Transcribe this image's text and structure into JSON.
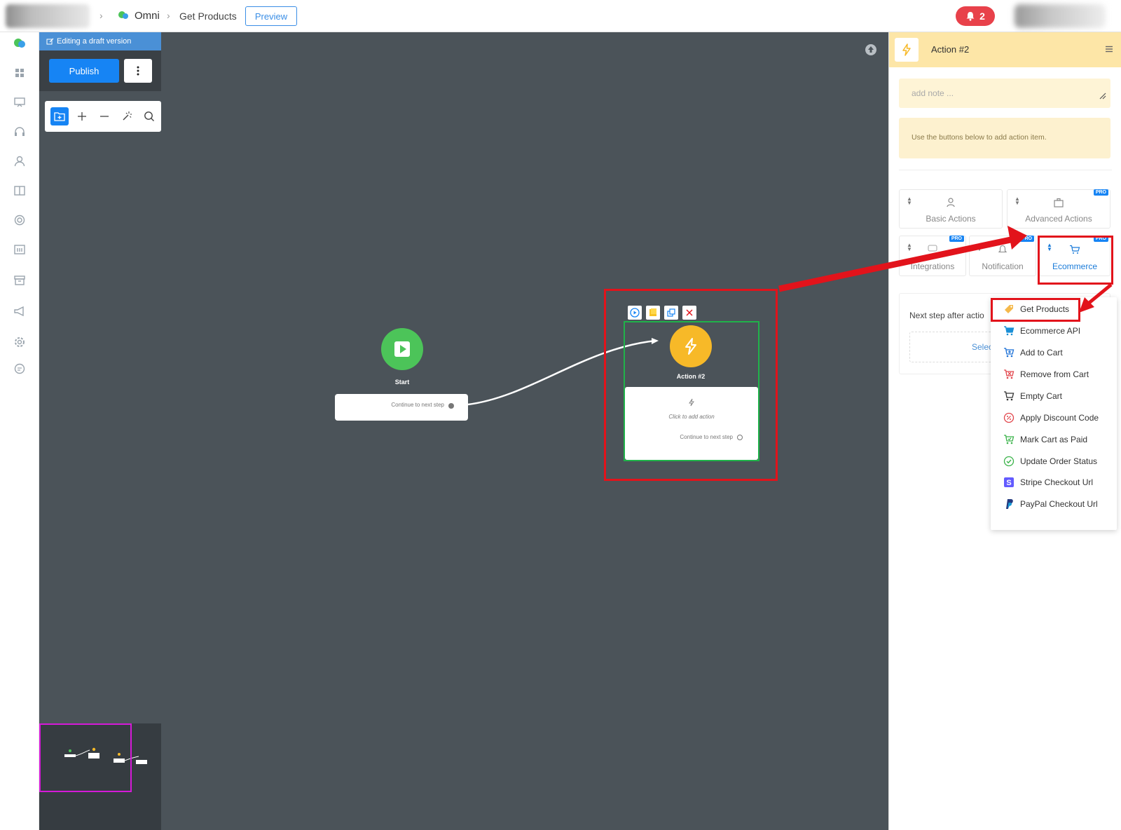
{
  "topbar": {
    "app_name": "Omni",
    "page_name": "Get Products",
    "preview_label": "Preview",
    "notification_count": "2"
  },
  "canvas": {
    "draft_label": "Editing a draft version",
    "publish_label": "Publish",
    "start_node": {
      "label": "Start",
      "continue_text": "Continue to next step"
    },
    "action_node": {
      "label": "Action #2",
      "click_text": "Click to add action",
      "continue_text": "Continue to next step"
    }
  },
  "panel": {
    "title": "Action #2",
    "note_placeholder": "add note ...",
    "hint": "Use the buttons below to add action item.",
    "categories": [
      {
        "label": "Basic Actions",
        "pro": ""
      },
      {
        "label": "Advanced Actions",
        "pro": "PRO"
      },
      {
        "label": "Integrations",
        "pro": "PRO"
      },
      {
        "label": "Notification",
        "pro": "PRO"
      },
      {
        "label": "Ecommerce",
        "pro": "PRO"
      }
    ],
    "next_step_label": "Next step after actio",
    "select_label": "Selec"
  },
  "dropdown": {
    "items": [
      {
        "label": "Get Products",
        "icon": "tag-icon"
      },
      {
        "label": "Ecommerce API",
        "icon": "cart-icon"
      },
      {
        "label": "Add to Cart",
        "icon": "cart-add-icon"
      },
      {
        "label": "Remove from Cart",
        "icon": "cart-remove-icon"
      },
      {
        "label": "Empty Cart",
        "icon": "cart-empty-icon"
      },
      {
        "label": "Apply Discount Code",
        "icon": "discount-icon"
      },
      {
        "label": "Mark Cart as Paid",
        "icon": "cart-paid-icon"
      },
      {
        "label": "Update Order Status",
        "icon": "check-circle-icon"
      },
      {
        "label": "Stripe Checkout Url",
        "icon": "stripe-icon"
      },
      {
        "label": "PayPal Checkout Url",
        "icon": "paypal-icon"
      }
    ]
  },
  "colors": {
    "accent": "#1684f4",
    "highlight": "#e2131b",
    "start_green": "#4cc459",
    "action_yellow": "#f7b928"
  }
}
